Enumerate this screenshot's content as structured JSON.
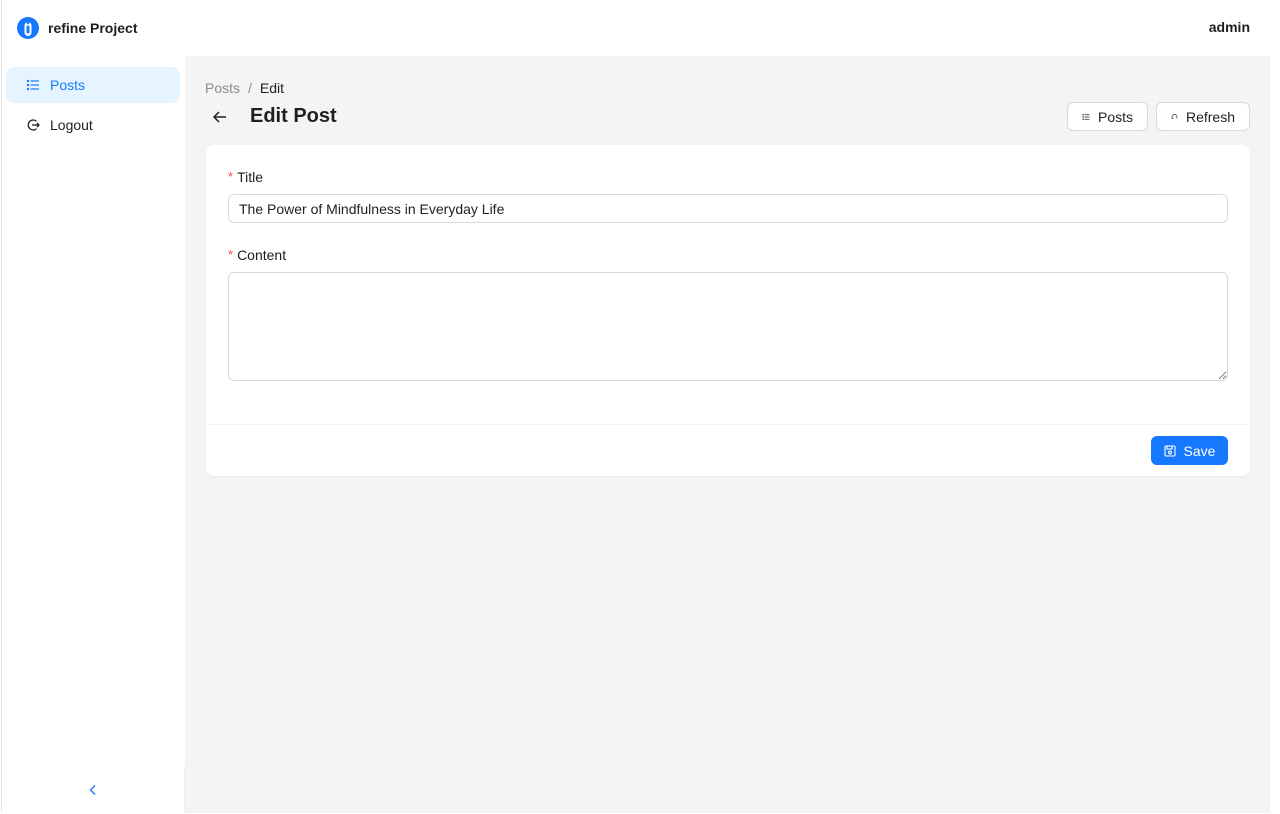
{
  "brand": {
    "title": "refine Project",
    "logo_icon": "refine-logo-icon"
  },
  "header": {
    "user": "admin"
  },
  "sidebar": {
    "items": [
      {
        "label": "Posts",
        "icon": "list-icon",
        "active": true
      },
      {
        "label": "Logout",
        "icon": "logout-icon",
        "active": false
      }
    ],
    "collapse_icon": "chevron-left-icon"
  },
  "breadcrumb": {
    "items": [
      "Posts",
      "Edit"
    ],
    "separator": "/"
  },
  "page": {
    "title": "Edit Post",
    "actions": {
      "posts_label": "Posts",
      "refresh_label": "Refresh"
    }
  },
  "form": {
    "title_label": "Title",
    "title_value": "The Power of Mindfulness in Everyday Life",
    "content_label": "Content",
    "content_value": "",
    "required_mark": "*",
    "save_label": "Save"
  },
  "colors": {
    "primary": "#1677ff",
    "active_bg": "#e6f4ff",
    "required": "#ff4d4f",
    "content_bg": "#f4f4f4"
  }
}
